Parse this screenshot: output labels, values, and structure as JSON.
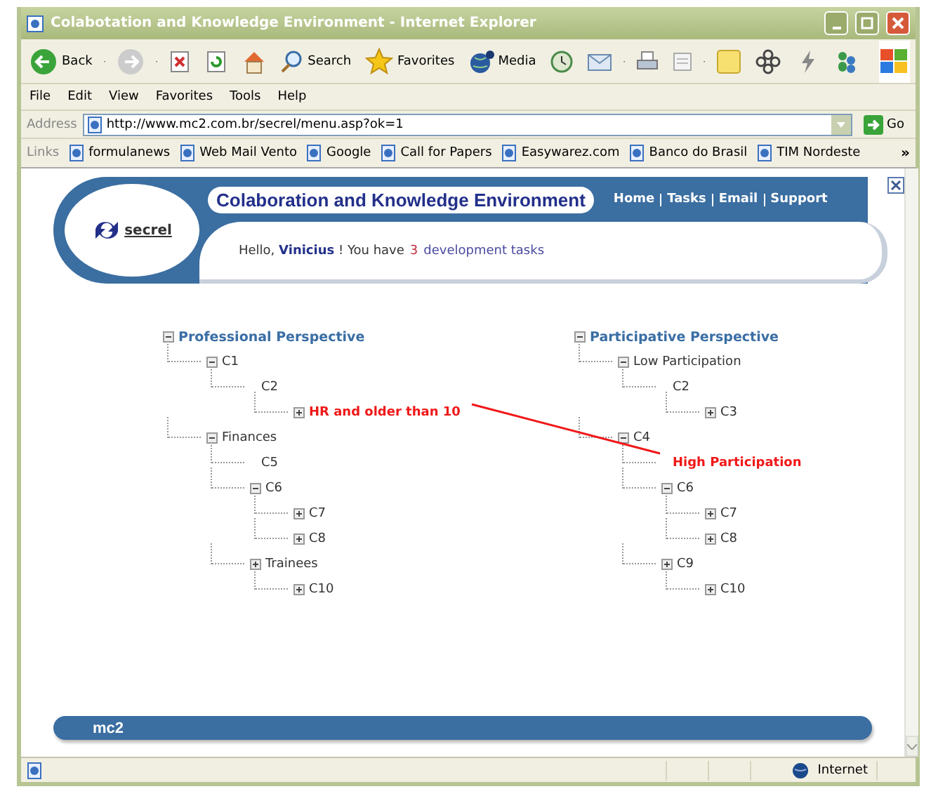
{
  "window": {
    "title": "Colabotation and Knowledge Environment - Internet Explorer"
  },
  "toolbar": [
    {
      "label": "Back"
    },
    {
      "label": "Search"
    },
    {
      "label": "Favorites"
    },
    {
      "label": "Media"
    }
  ],
  "menu": [
    "File",
    "Edit",
    "View",
    "Favorites",
    "Tools",
    "Help"
  ],
  "address": {
    "label": "Address",
    "value": "http://www.mc2.com.br/secrel/menu.asp?ok=1",
    "go": "Go"
  },
  "links": {
    "label": "Links",
    "items": [
      "formulanews",
      "Web Mail Vento",
      "Google",
      "Call for Papers",
      "Easywarez.com",
      "Banco do Brasil",
      "TIM Nordeste"
    ],
    "overflow": "»"
  },
  "banner": {
    "logo": "secrel",
    "title": "Colaboration and Knowledge Environment",
    "nav": [
      "Home",
      "Tasks",
      "Email",
      "Support"
    ],
    "greeting": "Hello, **Vinicius** ! You have",
    "task_count": "3",
    "task_link": "development tasks"
  },
  "trees": [
    {
      "label": "Professional Perspective",
      "kind": "heading",
      "expanded": true,
      "children": [
        {
          "label": "C1",
          "kind": "item",
          "expanded": true,
          "children": [
            {
              "label": "C2",
              "kind": "item",
              "children": [
                {
                  "label": "HR and older than 10",
                  "kind": "highlight",
                  "expanded": false
                }
              ]
            }
          ]
        },
        {
          "label": "Finances",
          "kind": "item",
          "expanded": true,
          "children": [
            {
              "label": "C5",
              "kind": "item"
            },
            {
              "label": "C6",
              "kind": "item",
              "expanded": true,
              "children": [
                {
                  "label": "C7",
                  "kind": "item",
                  "expanded": false
                },
                {
                  "label": "C8",
                  "kind": "item",
                  "expanded": false
                }
              ]
            },
            {
              "label": "Trainees",
              "kind": "item",
              "expanded": false,
              "children": [
                {
                  "label": "C10",
                  "kind": "item",
                  "expanded": false
                }
              ]
            }
          ]
        }
      ]
    },
    {
      "label": "Participative Perspective",
      "kind": "heading",
      "expanded": true,
      "children": [
        {
          "label": "Low Participation",
          "kind": "item",
          "expanded": true,
          "children": [
            {
              "label": "C2",
              "kind": "item",
              "children": [
                {
                  "label": "C3",
                  "kind": "item",
                  "expanded": false
                }
              ]
            }
          ]
        },
        {
          "label": "C4",
          "kind": "item",
          "expanded": true,
          "children": [
            {
              "label": "High Participation",
              "kind": "highlight"
            },
            {
              "label": "C6",
              "kind": "item",
              "expanded": true,
              "children": [
                {
                  "label": "C7",
                  "kind": "item",
                  "expanded": false
                },
                {
                  "label": "C8",
                  "kind": "item",
                  "expanded": false
                }
              ]
            },
            {
              "label": "C9",
              "kind": "item",
              "expanded": false,
              "children": [
                {
                  "label": "C10",
                  "kind": "item",
                  "expanded": false
                }
              ]
            }
          ]
        }
      ]
    }
  ],
  "footer": {
    "logo": "mc2"
  },
  "status_bar": {
    "zone": "Internet"
  }
}
